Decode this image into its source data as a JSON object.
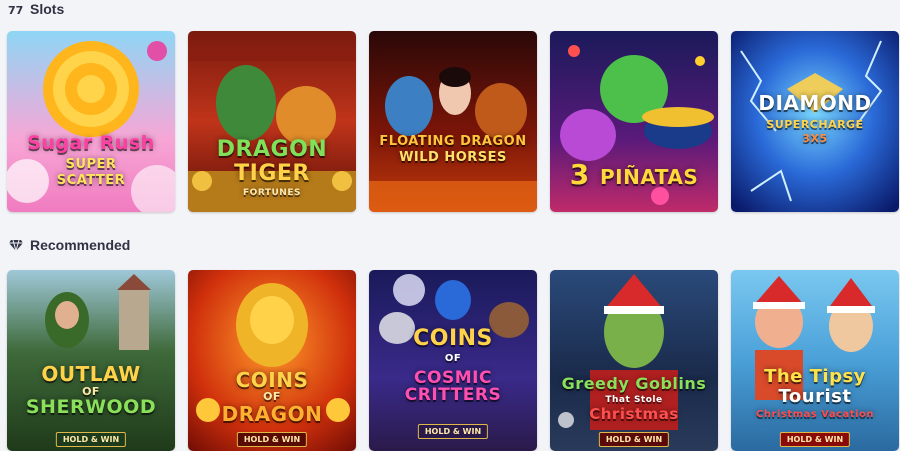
{
  "sections": [
    {
      "title": "Slots",
      "icon": "slot-machine-icon",
      "games": [
        {
          "line1": "Sugar Rush",
          "line2": "SUPER",
          "line3": "SCATTER",
          "badge": ""
        },
        {
          "line1": "DRAGON",
          "line2": "TIGER",
          "line3": "FORTUNES",
          "badge": ""
        },
        {
          "line1": "FLOATING DRAGON",
          "line2": "WILD HORSES",
          "line3": "",
          "badge": ""
        },
        {
          "line1": "3",
          "line2": "PIÑATAS",
          "line3": "",
          "badge": ""
        },
        {
          "line1": "DIAMOND",
          "line2": "SUPERCHARGE",
          "line3": "3X5",
          "badge": ""
        }
      ]
    },
    {
      "title": "Recommended",
      "icon": "diamond-icon",
      "games": [
        {
          "line1": "OUTLAW",
          "line2": "OF",
          "line3": "SHERWOOD",
          "badge": "HOLD & WIN"
        },
        {
          "line1": "COINS",
          "line2": "OF",
          "line3": "DRAGON",
          "badge": "HOLD & WIN"
        },
        {
          "line1": "COINS",
          "line2": "OF",
          "line3": "COSMIC CRITTERS",
          "badge": "HOLD & WIN"
        },
        {
          "line1": "Greedy Goblins",
          "line2": "That Stole",
          "line3": "Christmas",
          "badge": "HOLD & WIN"
        },
        {
          "line1": "The Tipsy",
          "line2": "Tourist",
          "line3": "Christmas Vacation",
          "badge": "HOLD & WIN"
        }
      ]
    }
  ]
}
